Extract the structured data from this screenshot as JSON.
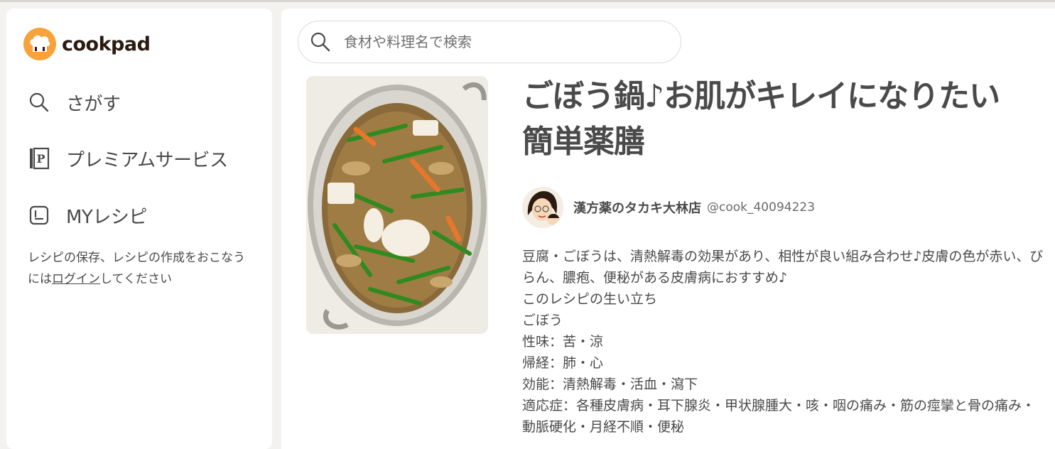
{
  "brand": {
    "name": "cookpad",
    "accent": "#f7a23a"
  },
  "sidebar": {
    "items": [
      {
        "label": "さがす",
        "icon": "search-icon"
      },
      {
        "label": "プレミアムサービス",
        "icon": "premium-icon"
      },
      {
        "label": "MYレシピ",
        "icon": "my-recipe-icon"
      }
    ],
    "login_note": {
      "before": "レシピの保存、レシピの作成をおこなうには",
      "link": "ログイン",
      "after": "してください"
    }
  },
  "search": {
    "placeholder": "食材や料理名で検索"
  },
  "recipe": {
    "title": "ごぼう鍋♪お肌がキレイになりたい簡単薬膳",
    "photo_alt": "ごぼう鍋",
    "author": {
      "name": "漢方薬のタカキ大林店",
      "handle": "@cook_40094223"
    },
    "description_lines": [
      "豆腐・ごぼうは、清熱解毒の効果があり、相性が良い組み合わせ♪皮膚の色が赤い、び",
      "らん、膿疱、便秘がある皮膚病におすすめ♪",
      "このレシピの生い立ち",
      "ごぼう",
      "性味：苦・涼",
      "帰経：肺・心",
      "効能：清熱解毒・活血・瀉下",
      "適応症：各種皮膚病・耳下腺炎・甲状腺腫大・咳・咽の痛み・筋の痙攣と骨の痛み・",
      "動脈硬化・月経不順・便秘"
    ]
  }
}
